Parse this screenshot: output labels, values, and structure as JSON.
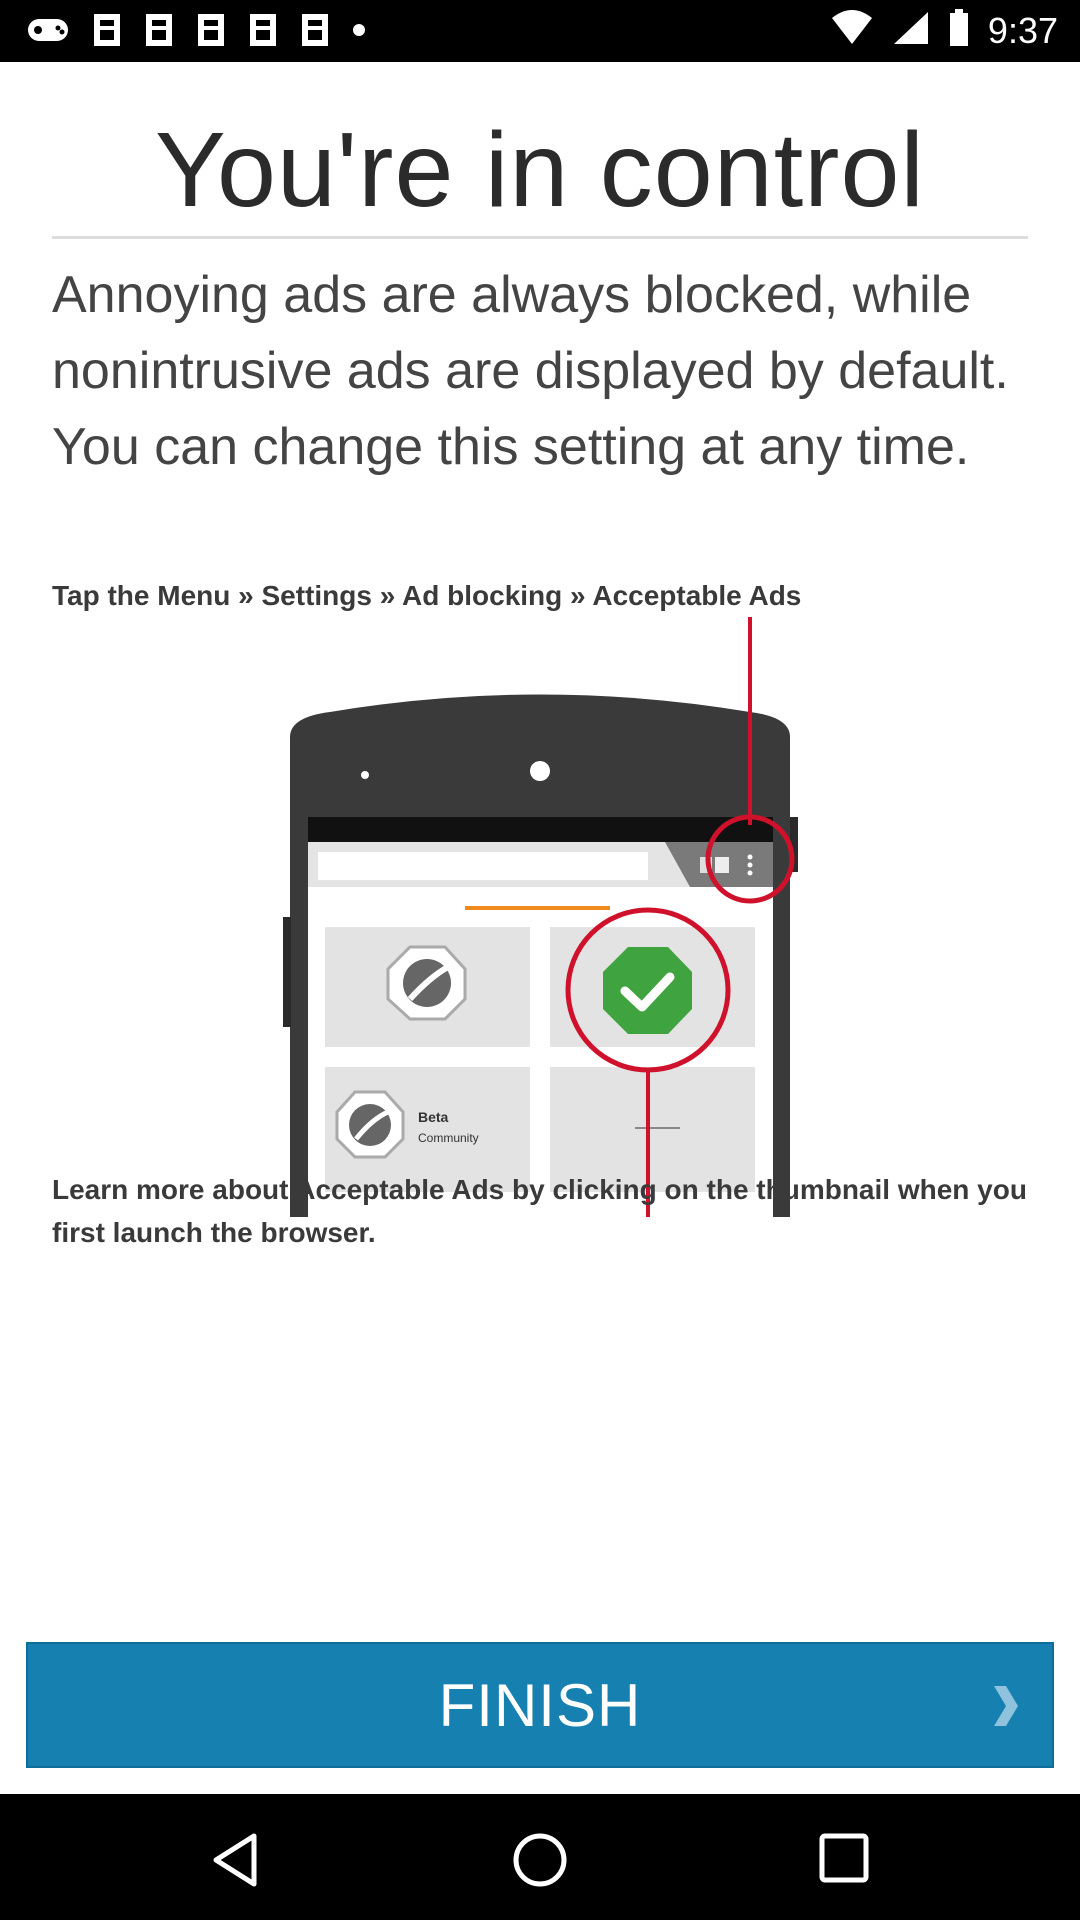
{
  "status_bar": {
    "time": "9:37",
    "icons": [
      "gamepad-icon",
      "image-icon",
      "image-icon",
      "image-icon",
      "image-icon",
      "image-icon",
      "dot-icon"
    ],
    "right_icons": [
      "wifi-icon",
      "signal-icon",
      "battery-icon"
    ]
  },
  "page": {
    "title": "You're in control",
    "lead": "Annoying ads are always blocked, while nonintrusive ads are displayed by default. You can change this setting at any time.",
    "instruction": "Tap the Menu » Settings » Ad blocking » Acceptable Ads",
    "learn_more": "Learn more about Acceptable Ads by clicking on the thumbnail when you first launch the browser."
  },
  "illustration": {
    "tile_label_line1": "Beta",
    "tile_label_line2": "Community",
    "accent_color": "#d0112b",
    "check_color": "#3fa33f"
  },
  "finish_button": {
    "label": "FINISH",
    "color": "#1680b1",
    "icon": "chevron-right-icon"
  },
  "nav_bar": {
    "icons": [
      "back-icon",
      "home-icon",
      "recents-icon"
    ]
  }
}
